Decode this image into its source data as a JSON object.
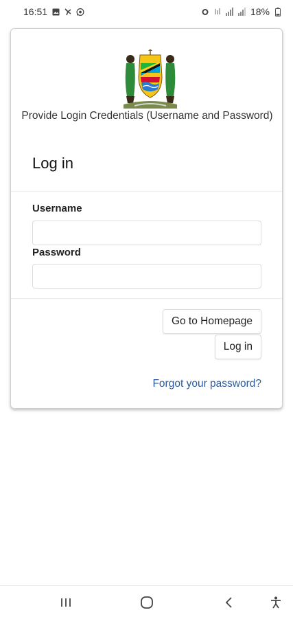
{
  "status_bar": {
    "time": "16:51",
    "battery": "18%",
    "left_icons": [
      "gallery-icon",
      "fan-icon",
      "whatsapp-icon"
    ],
    "right_icons": [
      "alarm-icon",
      "wifi-icon",
      "signal-icon",
      "signal-icon",
      "battery-icon"
    ]
  },
  "login_card": {
    "emblem_icon": "coat-of-arms-icon",
    "subtitle": "Provide Login Credentials (Username and Password)",
    "title": "Log in",
    "username_label": "Username",
    "username_value": "",
    "password_label": "Password",
    "password_value": "",
    "homepage_button": "Go to Homepage",
    "login_button": "Log in",
    "forgot_link": "Forgot your password?"
  },
  "nav_bar": {
    "buttons": [
      "recent-apps-icon",
      "home-icon",
      "back-icon",
      "accessibility-icon"
    ]
  },
  "colors": {
    "link": "#2a5b9c",
    "card_border": "#d0d0d0",
    "input_border": "#dcdcdc"
  }
}
